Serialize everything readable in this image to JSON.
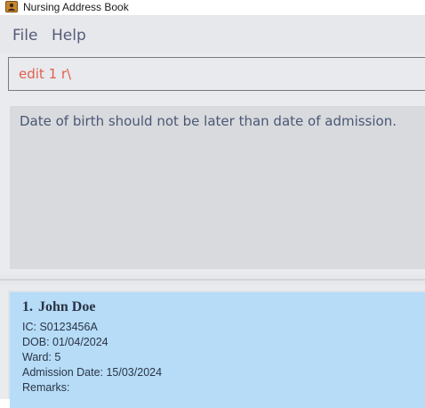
{
  "window": {
    "title": "Nursing Address Book",
    "icon": "address-book-icon"
  },
  "menu": {
    "items": [
      "File",
      "Help"
    ]
  },
  "command": {
    "value": "edit 1 r\\",
    "color": "#e06050"
  },
  "result": {
    "message": "Date of birth should not be later than date of admission."
  },
  "patients": [
    {
      "index": "1.",
      "name": "John Doe",
      "ic": "IC: S0123456A",
      "dob": "DOB: 01/04/2024",
      "ward": "Ward: 5",
      "admission": "Admission Date: 15/03/2024",
      "remarks": "Remarks:"
    }
  ],
  "colors": {
    "card_selected": "#b6dcf7",
    "accent": "#555a78"
  }
}
